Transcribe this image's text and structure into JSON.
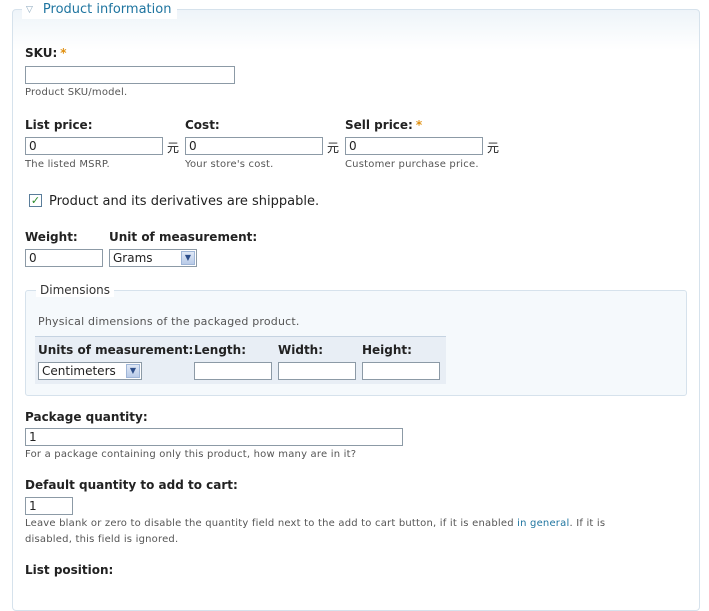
{
  "fieldset": {
    "legend": "Product information"
  },
  "sku": {
    "label": "SKU:",
    "required": "*",
    "value": "",
    "description": "Product SKU/model."
  },
  "list_price": {
    "label": "List price:",
    "value": "0",
    "currency": "元",
    "description": "The listed MSRP."
  },
  "cost": {
    "label": "Cost:",
    "value": "0",
    "currency": "元",
    "description": "Your store's cost."
  },
  "sell_price": {
    "label": "Sell price:",
    "required": "*",
    "value": "0",
    "currency": "元",
    "description": "Customer purchase price."
  },
  "shippable": {
    "checked": true,
    "label": "Product and its derivatives are shippable."
  },
  "weight": {
    "label": "Weight:",
    "value": "0"
  },
  "weight_unit": {
    "label": "Unit of measurement:",
    "selected": "Grams"
  },
  "dimensions": {
    "legend": "Dimensions",
    "description": "Physical dimensions of the packaged product.",
    "units_label": "Units of measurement:",
    "units_selected": "Centimeters",
    "length_label": "Length:",
    "width_label": "Width:",
    "height_label": "Height:",
    "length_value": "",
    "width_value": "",
    "height_value": ""
  },
  "package_quantity": {
    "label": "Package quantity:",
    "value": "1",
    "description": "For a package containing only this product, how many are in it?"
  },
  "default_qty": {
    "label": "Default quantity to add to cart:",
    "value": "1",
    "description_pre": "Leave blank or zero to disable the quantity field next to the add to cart button, if it is enabled ",
    "description_link": "in general",
    "description_post": ". If it is",
    "description_line2": "disabled, this field is ignored."
  },
  "list_position": {
    "label": "List position:"
  }
}
